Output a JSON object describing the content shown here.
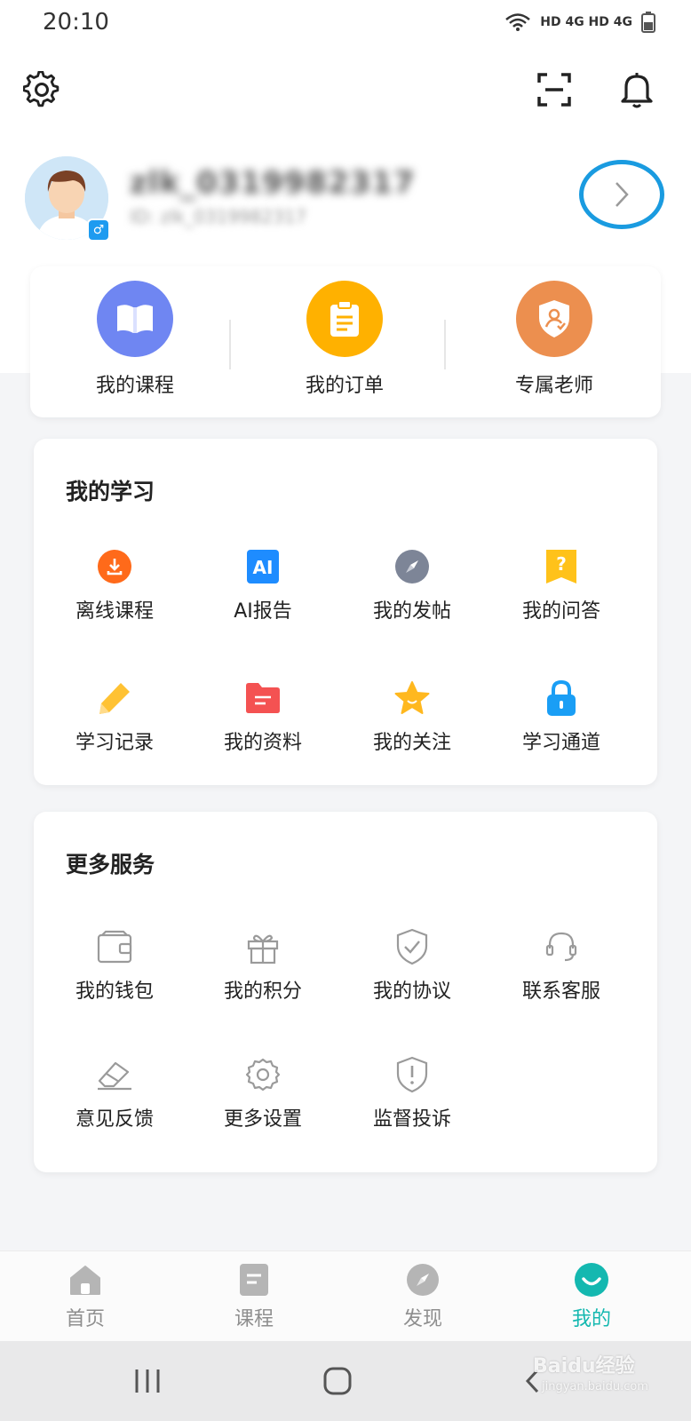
{
  "status_bar": {
    "time": "20:10",
    "indicators": "HD 4G HD 4G"
  },
  "top_bar": {
    "settings_icon": "gear-icon",
    "scan_icon": "scan-icon",
    "notification_icon": "bell-icon"
  },
  "profile": {
    "username": "zlk_0319982317",
    "user_id": "ID: zlk_0319982317",
    "gender_symbol": "♂"
  },
  "quick_actions": [
    {
      "label": "我的课程",
      "icon": "book-icon",
      "color": "#6f86f2"
    },
    {
      "label": "我的订单",
      "icon": "clipboard-icon",
      "color": "#ffb100"
    },
    {
      "label": "专属老师",
      "icon": "teacher-shield-icon",
      "color": "#ec8f4f"
    }
  ],
  "my_study": {
    "title": "我的学习",
    "items": [
      {
        "label": "离线课程",
        "icon": "download-icon"
      },
      {
        "label": "AI报告",
        "icon": "ai-icon"
      },
      {
        "label": "我的发帖",
        "icon": "compass-icon"
      },
      {
        "label": "我的问答",
        "icon": "question-icon"
      },
      {
        "label": "学习记录",
        "icon": "pencil-icon"
      },
      {
        "label": "我的资料",
        "icon": "folder-icon"
      },
      {
        "label": "我的关注",
        "icon": "star-icon"
      },
      {
        "label": "学习通道",
        "icon": "lock-icon"
      }
    ]
  },
  "more_services": {
    "title": "更多服务",
    "items": [
      {
        "label": "我的钱包",
        "icon": "wallet-icon"
      },
      {
        "label": "我的积分",
        "icon": "gift-icon"
      },
      {
        "label": "我的协议",
        "icon": "shield-check-icon"
      },
      {
        "label": "联系客服",
        "icon": "headset-icon"
      },
      {
        "label": "意见反馈",
        "icon": "eraser-icon"
      },
      {
        "label": "更多设置",
        "icon": "gear-icon"
      },
      {
        "label": "监督投诉",
        "icon": "warning-shield-icon"
      }
    ]
  },
  "tab_bar": {
    "active": "我的",
    "tabs": [
      {
        "label": "首页",
        "icon": "home-icon"
      },
      {
        "label": "课程",
        "icon": "course-icon"
      },
      {
        "label": "发现",
        "icon": "discover-icon"
      },
      {
        "label": "我的",
        "icon": "smile-icon"
      }
    ]
  },
  "watermark": {
    "text": "Baidu经验",
    "url_text": "jingyan.baidu.com"
  },
  "colors": {
    "accent": "#14b8b0",
    "highlight_ring": "#1a9be0"
  }
}
